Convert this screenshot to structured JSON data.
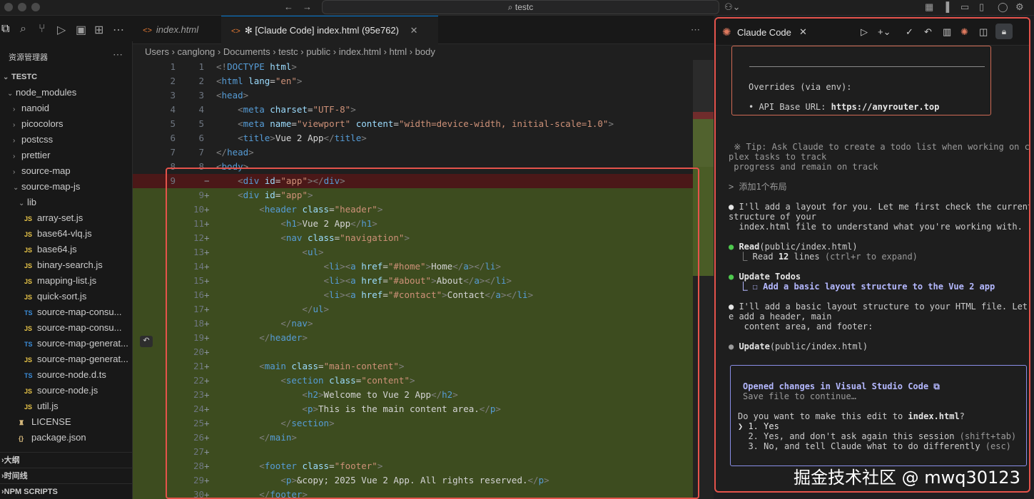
{
  "titlebar": {
    "search_text": "testc"
  },
  "sidebar": {
    "title": "资源管理器",
    "root": "TESTC",
    "tree": [
      {
        "label": "node_modules",
        "kind": "folder-open",
        "indent": 1
      },
      {
        "label": "nanoid",
        "kind": "folder",
        "indent": 2
      },
      {
        "label": "picocolors",
        "kind": "folder",
        "indent": 2
      },
      {
        "label": "postcss",
        "kind": "folder",
        "indent": 2
      },
      {
        "label": "prettier",
        "kind": "folder",
        "indent": 2
      },
      {
        "label": "source-map",
        "kind": "folder",
        "indent": 2
      },
      {
        "label": "source-map-js",
        "kind": "folder-open",
        "indent": 2
      },
      {
        "label": "lib",
        "kind": "folder-open",
        "indent": 3
      },
      {
        "label": "array-set.js",
        "kind": "JS",
        "indent": 4
      },
      {
        "label": "base64-vlq.js",
        "kind": "JS",
        "indent": 4
      },
      {
        "label": "base64.js",
        "kind": "JS",
        "indent": 4
      },
      {
        "label": "binary-search.js",
        "kind": "JS",
        "indent": 4
      },
      {
        "label": "mapping-list.js",
        "kind": "JS",
        "indent": 4
      },
      {
        "label": "quick-sort.js",
        "kind": "JS",
        "indent": 4
      },
      {
        "label": "source-map-consu...",
        "kind": "TS",
        "indent": 4
      },
      {
        "label": "source-map-consu...",
        "kind": "JS",
        "indent": 4
      },
      {
        "label": "source-map-generat...",
        "kind": "TS",
        "indent": 4
      },
      {
        "label": "source-map-generat...",
        "kind": "JS",
        "indent": 4
      },
      {
        "label": "source-node.d.ts",
        "kind": "TS",
        "indent": 4
      },
      {
        "label": "source-node.js",
        "kind": "JS",
        "indent": 4
      },
      {
        "label": "util.js",
        "kind": "JS",
        "indent": 4
      },
      {
        "label": "LICENSE",
        "kind": "license",
        "indent": 3
      },
      {
        "label": "package.json",
        "kind": "json",
        "indent": 3
      }
    ],
    "sections": [
      "大纲",
      "时间线",
      "NPM SCRIPTS"
    ]
  },
  "editor": {
    "tabs": [
      {
        "label": "index.html"
      },
      {
        "label": "✻ [Claude Code] index.html (95e762)"
      }
    ],
    "breadcrumb": [
      "Users",
      "canglong",
      "Documents",
      "testc",
      "public",
      "index.html",
      "html",
      "body"
    ],
    "lines": [
      {
        "ln1": "1",
        "ln2": "1",
        "mark": "",
        "type": "normal",
        "html": "<span class='p'>&lt;!</span><span class='t'>DOCTYPE</span> <span class='a'>html</span><span class='p'>&gt;</span>"
      },
      {
        "ln1": "2",
        "ln2": "2",
        "mark": "",
        "type": "normal",
        "html": "<span class='p'>&lt;</span><span class='t'>html</span> <span class='a'>lang</span>=<span class='s'>\"en\"</span><span class='p'>&gt;</span>"
      },
      {
        "ln1": "3",
        "ln2": "3",
        "mark": "",
        "type": "normal",
        "html": "<span class='p'>&lt;</span><span class='t'>head</span><span class='p'>&gt;</span>"
      },
      {
        "ln1": "4",
        "ln2": "4",
        "mark": "",
        "type": "normal",
        "html": "    <span class='p'>&lt;</span><span class='t'>meta</span> <span class='a'>charset</span>=<span class='s'>\"UTF-8\"</span><span class='p'>&gt;</span>"
      },
      {
        "ln1": "5",
        "ln2": "5",
        "mark": "",
        "type": "normal",
        "html": "    <span class='p'>&lt;</span><span class='t'>meta</span> <span class='a'>name</span>=<span class='s'>\"viewport\"</span> <span class='a'>content</span>=<span class='s'>\"width=device-width, initial-scale=1.0\"</span><span class='p'>&gt;</span>"
      },
      {
        "ln1": "6",
        "ln2": "6",
        "mark": "",
        "type": "normal",
        "html": "    <span class='p'>&lt;</span><span class='t'>title</span><span class='p'>&gt;</span><span class='tx'>Vue 2 App</span><span class='p'>&lt;/</span><span class='t'>title</span><span class='p'>&gt;</span>"
      },
      {
        "ln1": "7",
        "ln2": "7",
        "mark": "",
        "type": "normal",
        "html": "<span class='p'>&lt;/</span><span class='t'>head</span><span class='p'>&gt;</span>"
      },
      {
        "ln1": "8",
        "ln2": "8",
        "mark": "",
        "type": "normal",
        "html": "<span class='p'>&lt;</span><span class='t'>body</span><span class='p'>&gt;</span>"
      },
      {
        "ln1": "9",
        "ln2": "",
        "mark": "−",
        "type": "removed",
        "html": "    <span class='p'>&lt;</span><span class='t'>div</span> <span class='a'>id</span>=<span class='s'>\"app\"</span><span class='p'>&gt;&lt;/</span><span class='t'>div</span><span class='p'>&gt;</span>"
      },
      {
        "ln1": "",
        "ln2": "9",
        "mark": "+",
        "type": "added",
        "html": "    <span class='p'>&lt;</span><span class='t'>div</span> <span class='a'>id</span>=<span class='s'>\"app\"</span><span class='p'>&gt;</span>"
      },
      {
        "ln1": "",
        "ln2": "10",
        "mark": "+",
        "type": "added",
        "html": "        <span class='p'>&lt;</span><span class='t'>header</span> <span class='a'>class</span>=<span class='s'>\"header\"</span><span class='p'>&gt;</span>"
      },
      {
        "ln1": "",
        "ln2": "11",
        "mark": "+",
        "type": "added",
        "html": "            <span class='p'>&lt;</span><span class='t'>h1</span><span class='p'>&gt;</span><span class='tx'>Vue 2 App</span><span class='p'>&lt;/</span><span class='t'>h1</span><span class='p'>&gt;</span>"
      },
      {
        "ln1": "",
        "ln2": "12",
        "mark": "+",
        "type": "added",
        "html": "            <span class='p'>&lt;</span><span class='t'>nav</span> <span class='a'>class</span>=<span class='s'>\"navigation\"</span><span class='p'>&gt;</span>"
      },
      {
        "ln1": "",
        "ln2": "13",
        "mark": "+",
        "type": "added",
        "html": "                <span class='p'>&lt;</span><span class='t'>ul</span><span class='p'>&gt;</span>"
      },
      {
        "ln1": "",
        "ln2": "14",
        "mark": "+",
        "type": "added",
        "html": "                    <span class='p'>&lt;</span><span class='t'>li</span><span class='p'>&gt;&lt;</span><span class='t'>a</span> <span class='a'>href</span>=<span class='s'>\"#home\"</span><span class='p'>&gt;</span><span class='tx'>Home</span><span class='p'>&lt;/</span><span class='t'>a</span><span class='p'>&gt;&lt;/</span><span class='t'>li</span><span class='p'>&gt;</span>"
      },
      {
        "ln1": "",
        "ln2": "15",
        "mark": "+",
        "type": "added",
        "html": "                    <span class='p'>&lt;</span><span class='t'>li</span><span class='p'>&gt;&lt;</span><span class='t'>a</span> <span class='a'>href</span>=<span class='s'>\"#about\"</span><span class='p'>&gt;</span><span class='tx'>About</span><span class='p'>&lt;/</span><span class='t'>a</span><span class='p'>&gt;&lt;/</span><span class='t'>li</span><span class='p'>&gt;</span>"
      },
      {
        "ln1": "",
        "ln2": "16",
        "mark": "+",
        "type": "added",
        "html": "                    <span class='p'>&lt;</span><span class='t'>li</span><span class='p'>&gt;&lt;</span><span class='t'>a</span> <span class='a'>href</span>=<span class='s'>\"#contact\"</span><span class='p'>&gt;</span><span class='tx'>Contact</span><span class='p'>&lt;/</span><span class='t'>a</span><span class='p'>&gt;&lt;/</span><span class='t'>li</span><span class='p'>&gt;</span>"
      },
      {
        "ln1": "",
        "ln2": "17",
        "mark": "+",
        "type": "added",
        "html": "                <span class='p'>&lt;/</span><span class='t'>ul</span><span class='p'>&gt;</span>"
      },
      {
        "ln1": "",
        "ln2": "18",
        "mark": "+",
        "type": "added",
        "html": "            <span class='p'>&lt;/</span><span class='t'>nav</span><span class='p'>&gt;</span>"
      },
      {
        "ln1": "",
        "ln2": "19",
        "mark": "+",
        "type": "added",
        "html": "        <span class='p'>&lt;/</span><span class='t'>header</span><span class='p'>&gt;</span>"
      },
      {
        "ln1": "",
        "ln2": "20",
        "mark": "+",
        "type": "added",
        "html": ""
      },
      {
        "ln1": "",
        "ln2": "21",
        "mark": "+",
        "type": "added",
        "html": "        <span class='p'>&lt;</span><span class='t'>main</span> <span class='a'>class</span>=<span class='s'>\"main-content\"</span><span class='p'>&gt;</span>"
      },
      {
        "ln1": "",
        "ln2": "22",
        "mark": "+",
        "type": "added",
        "html": "            <span class='p'>&lt;</span><span class='t'>section</span> <span class='a'>class</span>=<span class='s'>\"content\"</span><span class='p'>&gt;</span>"
      },
      {
        "ln1": "",
        "ln2": "23",
        "mark": "+",
        "type": "added",
        "html": "                <span class='p'>&lt;</span><span class='t'>h2</span><span class='p'>&gt;</span><span class='tx'>Welcome to Vue 2 App</span><span class='p'>&lt;/</span><span class='t'>h2</span><span class='p'>&gt;</span>"
      },
      {
        "ln1": "",
        "ln2": "24",
        "mark": "+",
        "type": "added",
        "html": "                <span class='p'>&lt;</span><span class='t'>p</span><span class='p'>&gt;</span><span class='tx'>This is the main content area.</span><span class='p'>&lt;/</span><span class='t'>p</span><span class='p'>&gt;</span>"
      },
      {
        "ln1": "",
        "ln2": "25",
        "mark": "+",
        "type": "added",
        "html": "            <span class='p'>&lt;/</span><span class='t'>section</span><span class='p'>&gt;</span>"
      },
      {
        "ln1": "",
        "ln2": "26",
        "mark": "+",
        "type": "added",
        "html": "        <span class='p'>&lt;/</span><span class='t'>main</span><span class='p'>&gt;</span>"
      },
      {
        "ln1": "",
        "ln2": "27",
        "mark": "+",
        "type": "added",
        "html": ""
      },
      {
        "ln1": "",
        "ln2": "28",
        "mark": "+",
        "type": "added",
        "html": "        <span class='p'>&lt;</span><span class='t'>footer</span> <span class='a'>class</span>=<span class='s'>\"footer\"</span><span class='p'>&gt;</span>"
      },
      {
        "ln1": "",
        "ln2": "29",
        "mark": "+",
        "type": "added",
        "html": "            <span class='p'>&lt;</span><span class='t'>p</span><span class='p'>&gt;</span><span class='tx'>&amp;copy; 2025 Vue 2 App. All rights reserved.</span><span class='p'>&lt;/</span><span class='t'>p</span><span class='p'>&gt;</span>"
      },
      {
        "ln1": "",
        "ln2": "30",
        "mark": "+",
        "type": "added",
        "html": "        <span class='p'>&lt;/</span><span class='t'>footer</span><span class='p'>&gt;</span>"
      }
    ]
  },
  "claude": {
    "title": "Claude Code",
    "overrides_label": "Overrides (via env):",
    "api_base": "• API Base URL: ",
    "api_url": "https://anyrouter.top",
    "tip_line1": " ※ Tip: Ask Claude to create a todo list when working on com",
    "tip_line2": "plex tasks to track",
    "tip_line3": " progress and remain on track",
    "prompt": "> 添加1个布局",
    "msg1_line1": "I'll add a layout for you. Let me first check the current",
    "msg1_line2": "structure of your",
    "msg1_line3": "  index.html file to understand what you're working with.",
    "read_label": "Read",
    "read_arg": "(public/index.html)",
    "read_result_pre": "  ⎿ Read ",
    "read_result_count": "12",
    "read_result_mid": " lines ",
    "read_result_hint": "(ctrl+r to expand)",
    "todos_label": "Update Todos",
    "todo_item": "  ⎿ ☐ Add a basic layout structure to the Vue 2 app",
    "msg2_line1": "I'll add a basic layout structure to your HTML file. Let m",
    "msg2_line2": "e add a header, main",
    "msg2_line3": "   content area, and footer:",
    "update_label": "Update",
    "update_arg": "(public/index.html)",
    "opened_changes": "Opened changes in Visual Studio Code ⧉",
    "save_hint": "Save file to continue…",
    "question_pre": "Do you want to make this edit to ",
    "question_file": "index.html",
    "question_post": "?",
    "opt1": "❯ 1. Yes",
    "opt2": "  2. Yes, and don't ask again this session ",
    "opt2_hint": "(shift+tab)",
    "opt3": "  3. No, and tell Claude what to do differently ",
    "opt3_hint": "(esc)"
  },
  "watermark": "掘金技术社区 @ mwq30123",
  "colors": {
    "highlight_border": "#e5534b",
    "added_bg": "#3d4c1f",
    "removed_bg": "#4b1818"
  }
}
